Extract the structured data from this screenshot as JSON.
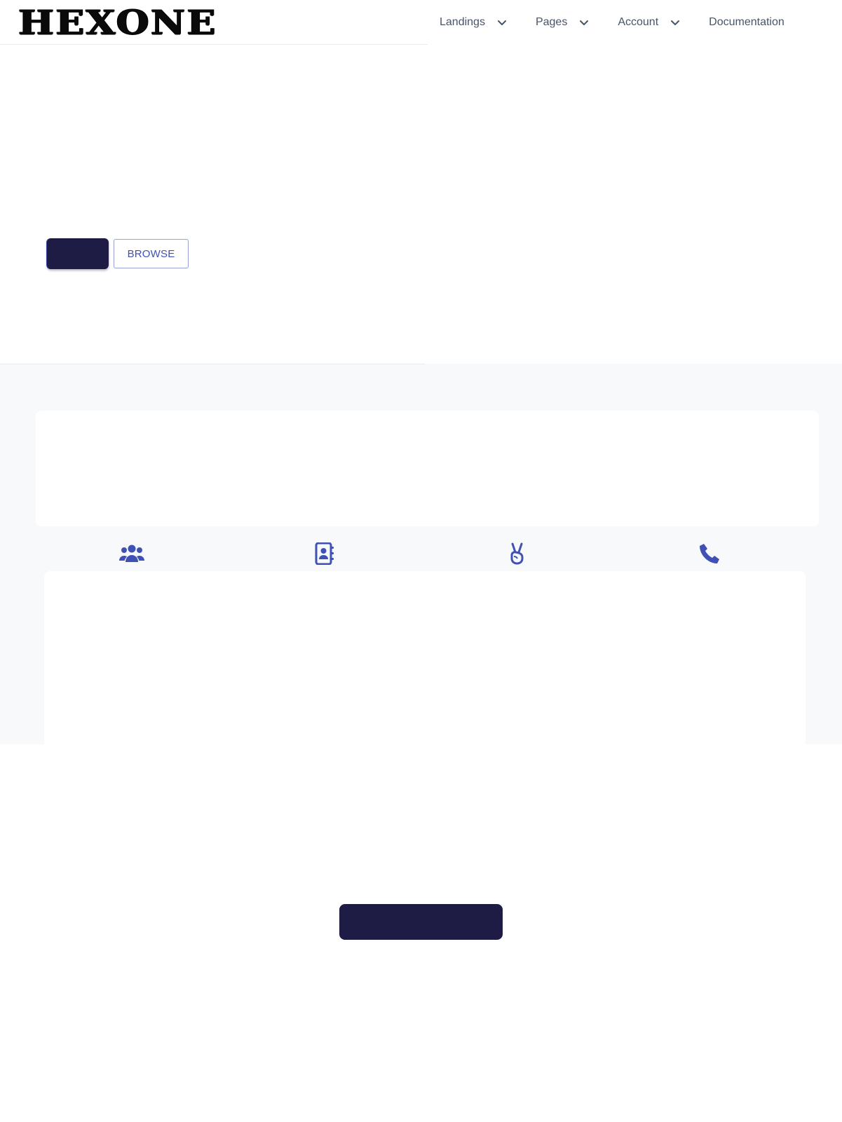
{
  "header": {
    "logo_text": "HEXONE",
    "nav": [
      {
        "label": "Landings",
        "has_dropdown": true,
        "icon": "chevron-down-icon"
      },
      {
        "label": "Pages",
        "has_dropdown": true,
        "icon": "chevron-down-icon"
      },
      {
        "label": "Account",
        "has_dropdown": true,
        "icon": "chevron-down-icon"
      },
      {
        "label": "Documentation",
        "has_dropdown": false
      }
    ]
  },
  "hero": {
    "primary_button_label": "",
    "browse_button_label": "BROWSE"
  },
  "features": [
    {
      "icon": "users-icon"
    },
    {
      "icon": "address-book-icon"
    },
    {
      "icon": "peace-hand-icon"
    },
    {
      "icon": "phone-icon"
    }
  ],
  "cta": {
    "button_label": ""
  },
  "colors": {
    "primary_dark": "#1e1b45",
    "accent_indigo": "#3f51b5",
    "nav_text": "#475569",
    "section_grey": "#f8f9fb"
  }
}
